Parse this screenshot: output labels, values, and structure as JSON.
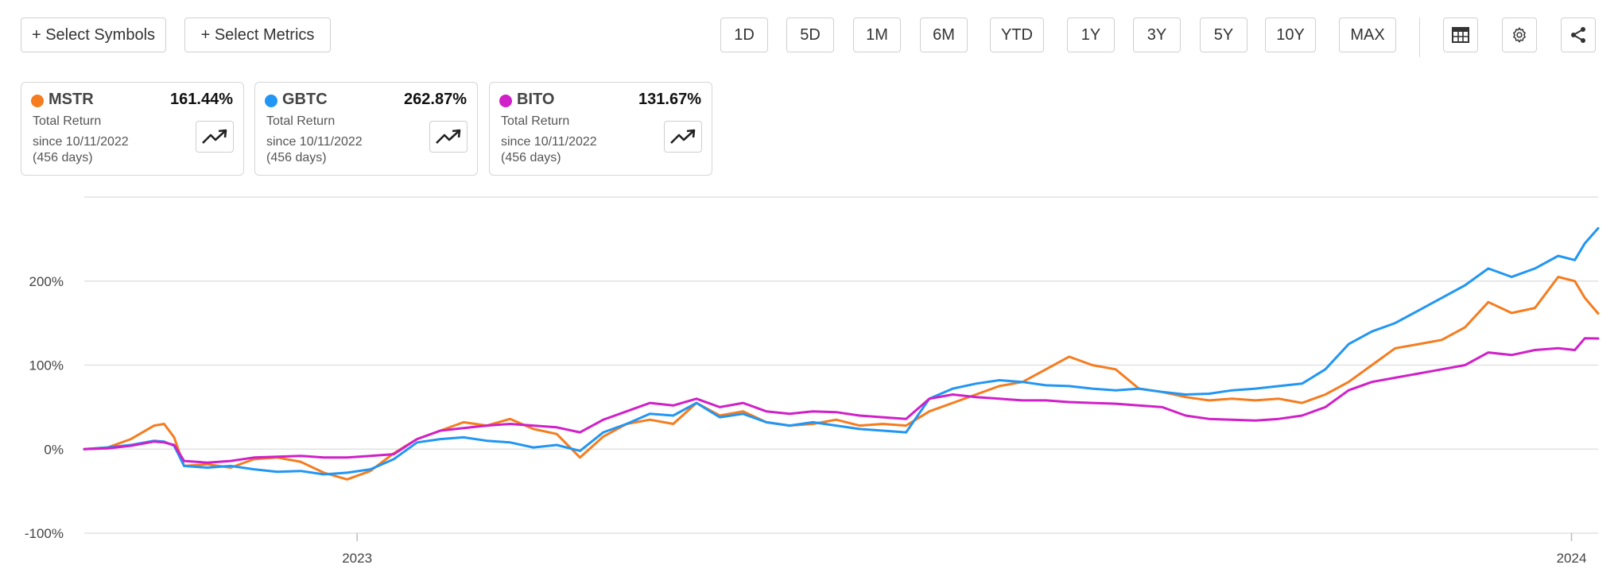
{
  "toolbar": {
    "select_symbols_label": "+ Select Symbols",
    "select_metrics_label": "+ Select Metrics",
    "ranges": [
      "1D",
      "5D",
      "1M",
      "6M",
      "YTD",
      "1Y",
      "3Y",
      "5Y",
      "10Y",
      "MAX"
    ],
    "icons": [
      "table-icon",
      "gear-icon",
      "share-icon"
    ]
  },
  "cards": [
    {
      "symbol": "MSTR",
      "value": "161.44%",
      "metric": "Total Return",
      "since": "since 10/11/2022",
      "days": "(456 days)",
      "color": "#f57c1f"
    },
    {
      "symbol": "GBTC",
      "value": "262.87%",
      "metric": "Total Return",
      "since": "since 10/11/2022",
      "days": "(456 days)",
      "color": "#2196f3"
    },
    {
      "symbol": "BITO",
      "value": "131.67%",
      "metric": "Total Return",
      "since": "since 10/11/2022",
      "days": "(456 days)",
      "color": "#d020c8"
    }
  ],
  "chart_data": {
    "type": "line",
    "ylim": [
      -100,
      300
    ],
    "yticks": [
      -100,
      0,
      100,
      200
    ],
    "ytick_labels": [
      "-100%",
      "0%",
      "100%",
      "200%"
    ],
    "xlim": [
      "2022-10-11",
      "2024-01-09"
    ],
    "xticks": [
      {
        "date": "2023-01-01",
        "label": "2023"
      },
      {
        "date": "2024-01-01",
        "label": "2024"
      }
    ],
    "grid": true,
    "legend": "none",
    "series": [
      {
        "name": "MSTR",
        "color": "#f57c1f",
        "points": [
          [
            "2022-10-11",
            0
          ],
          [
            "2022-10-18",
            2
          ],
          [
            "2022-10-25",
            12
          ],
          [
            "2022-11-01",
            28
          ],
          [
            "2022-11-04",
            30
          ],
          [
            "2022-11-07",
            14
          ],
          [
            "2022-11-10",
            -20
          ],
          [
            "2022-11-17",
            -18
          ],
          [
            "2022-11-24",
            -22
          ],
          [
            "2022-12-01",
            -12
          ],
          [
            "2022-12-08",
            -10
          ],
          [
            "2022-12-15",
            -15
          ],
          [
            "2022-12-22",
            -28
          ],
          [
            "2022-12-29",
            -36
          ],
          [
            "2023-01-05",
            -26
          ],
          [
            "2023-01-12",
            -5
          ],
          [
            "2023-01-19",
            12
          ],
          [
            "2023-01-26",
            22
          ],
          [
            "2023-02-02",
            32
          ],
          [
            "2023-02-09",
            28
          ],
          [
            "2023-02-16",
            36
          ],
          [
            "2023-02-23",
            24
          ],
          [
            "2023-03-02",
            18
          ],
          [
            "2023-03-09",
            -10
          ],
          [
            "2023-03-16",
            15
          ],
          [
            "2023-03-23",
            30
          ],
          [
            "2023-03-30",
            35
          ],
          [
            "2023-04-06",
            30
          ],
          [
            "2023-04-13",
            55
          ],
          [
            "2023-04-20",
            40
          ],
          [
            "2023-04-27",
            45
          ],
          [
            "2023-05-04",
            32
          ],
          [
            "2023-05-11",
            28
          ],
          [
            "2023-05-18",
            30
          ],
          [
            "2023-05-25",
            35
          ],
          [
            "2023-06-01",
            28
          ],
          [
            "2023-06-08",
            30
          ],
          [
            "2023-06-15",
            28
          ],
          [
            "2023-06-22",
            45
          ],
          [
            "2023-06-29",
            55
          ],
          [
            "2023-07-06",
            65
          ],
          [
            "2023-07-13",
            75
          ],
          [
            "2023-07-20",
            80
          ],
          [
            "2023-07-27",
            95
          ],
          [
            "2023-08-03",
            110
          ],
          [
            "2023-08-10",
            100
          ],
          [
            "2023-08-17",
            95
          ],
          [
            "2023-08-24",
            72
          ],
          [
            "2023-08-31",
            68
          ],
          [
            "2023-09-07",
            62
          ],
          [
            "2023-09-14",
            58
          ],
          [
            "2023-09-21",
            60
          ],
          [
            "2023-09-28",
            58
          ],
          [
            "2023-10-05",
            60
          ],
          [
            "2023-10-12",
            55
          ],
          [
            "2023-10-19",
            65
          ],
          [
            "2023-10-26",
            80
          ],
          [
            "2023-11-02",
            100
          ],
          [
            "2023-11-09",
            120
          ],
          [
            "2023-11-16",
            125
          ],
          [
            "2023-11-23",
            130
          ],
          [
            "2023-11-30",
            145
          ],
          [
            "2023-12-07",
            175
          ],
          [
            "2023-12-14",
            162
          ],
          [
            "2023-12-21",
            168
          ],
          [
            "2023-12-28",
            205
          ],
          [
            "2024-01-02",
            200
          ],
          [
            "2024-01-05",
            180
          ],
          [
            "2024-01-09",
            161.44
          ]
        ]
      },
      {
        "name": "GBTC",
        "color": "#2196f3",
        "points": [
          [
            "2022-10-11",
            0
          ],
          [
            "2022-10-18",
            2
          ],
          [
            "2022-10-25",
            5
          ],
          [
            "2022-11-01",
            10
          ],
          [
            "2022-11-04",
            9
          ],
          [
            "2022-11-07",
            4
          ],
          [
            "2022-11-10",
            -20
          ],
          [
            "2022-11-17",
            -22
          ],
          [
            "2022-11-24",
            -20
          ],
          [
            "2022-12-01",
            -24
          ],
          [
            "2022-12-08",
            -27
          ],
          [
            "2022-12-15",
            -26
          ],
          [
            "2022-12-22",
            -30
          ],
          [
            "2022-12-29",
            -28
          ],
          [
            "2023-01-05",
            -24
          ],
          [
            "2023-01-12",
            -12
          ],
          [
            "2023-01-19",
            8
          ],
          [
            "2023-01-26",
            12
          ],
          [
            "2023-02-02",
            14
          ],
          [
            "2023-02-09",
            10
          ],
          [
            "2023-02-16",
            8
          ],
          [
            "2023-02-23",
            2
          ],
          [
            "2023-03-02",
            5
          ],
          [
            "2023-03-09",
            -2
          ],
          [
            "2023-03-16",
            20
          ],
          [
            "2023-03-23",
            30
          ],
          [
            "2023-03-30",
            42
          ],
          [
            "2023-04-06",
            40
          ],
          [
            "2023-04-13",
            55
          ],
          [
            "2023-04-20",
            38
          ],
          [
            "2023-04-27",
            42
          ],
          [
            "2023-05-04",
            32
          ],
          [
            "2023-05-11",
            28
          ],
          [
            "2023-05-18",
            32
          ],
          [
            "2023-05-25",
            28
          ],
          [
            "2023-06-01",
            24
          ],
          [
            "2023-06-08",
            22
          ],
          [
            "2023-06-15",
            20
          ],
          [
            "2023-06-22",
            60
          ],
          [
            "2023-06-29",
            72
          ],
          [
            "2023-07-06",
            78
          ],
          [
            "2023-07-13",
            82
          ],
          [
            "2023-07-20",
            80
          ],
          [
            "2023-07-27",
            76
          ],
          [
            "2023-08-03",
            75
          ],
          [
            "2023-08-10",
            72
          ],
          [
            "2023-08-17",
            70
          ],
          [
            "2023-08-24",
            72
          ],
          [
            "2023-08-31",
            68
          ],
          [
            "2023-09-07",
            65
          ],
          [
            "2023-09-14",
            66
          ],
          [
            "2023-09-21",
            70
          ],
          [
            "2023-09-28",
            72
          ],
          [
            "2023-10-05",
            75
          ],
          [
            "2023-10-12",
            78
          ],
          [
            "2023-10-19",
            95
          ],
          [
            "2023-10-26",
            125
          ],
          [
            "2023-11-02",
            140
          ],
          [
            "2023-11-09",
            150
          ],
          [
            "2023-11-16",
            165
          ],
          [
            "2023-11-23",
            180
          ],
          [
            "2023-11-30",
            195
          ],
          [
            "2023-12-07",
            215
          ],
          [
            "2023-12-14",
            205
          ],
          [
            "2023-12-21",
            215
          ],
          [
            "2023-12-28",
            230
          ],
          [
            "2024-01-02",
            225
          ],
          [
            "2024-01-05",
            245
          ],
          [
            "2024-01-09",
            262.87
          ]
        ]
      },
      {
        "name": "BITO",
        "color": "#d020c8",
        "points": [
          [
            "2022-10-11",
            0
          ],
          [
            "2022-10-18",
            1
          ],
          [
            "2022-10-25",
            4
          ],
          [
            "2022-11-01",
            9
          ],
          [
            "2022-11-04",
            8
          ],
          [
            "2022-11-07",
            5
          ],
          [
            "2022-11-10",
            -14
          ],
          [
            "2022-11-17",
            -16
          ],
          [
            "2022-11-24",
            -14
          ],
          [
            "2022-12-01",
            -10
          ],
          [
            "2022-12-08",
            -9
          ],
          [
            "2022-12-15",
            -8
          ],
          [
            "2022-12-22",
            -10
          ],
          [
            "2022-12-29",
            -10
          ],
          [
            "2023-01-05",
            -8
          ],
          [
            "2023-01-12",
            -6
          ],
          [
            "2023-01-19",
            12
          ],
          [
            "2023-01-26",
            22
          ],
          [
            "2023-02-02",
            25
          ],
          [
            "2023-02-09",
            28
          ],
          [
            "2023-02-16",
            30
          ],
          [
            "2023-02-23",
            28
          ],
          [
            "2023-03-02",
            26
          ],
          [
            "2023-03-09",
            20
          ],
          [
            "2023-03-16",
            35
          ],
          [
            "2023-03-23",
            45
          ],
          [
            "2023-03-30",
            55
          ],
          [
            "2023-04-06",
            52
          ],
          [
            "2023-04-13",
            60
          ],
          [
            "2023-04-20",
            50
          ],
          [
            "2023-04-27",
            55
          ],
          [
            "2023-05-04",
            45
          ],
          [
            "2023-05-11",
            42
          ],
          [
            "2023-05-18",
            45
          ],
          [
            "2023-05-25",
            44
          ],
          [
            "2023-06-01",
            40
          ],
          [
            "2023-06-08",
            38
          ],
          [
            "2023-06-15",
            36
          ],
          [
            "2023-06-22",
            60
          ],
          [
            "2023-06-29",
            65
          ],
          [
            "2023-07-06",
            62
          ],
          [
            "2023-07-13",
            60
          ],
          [
            "2023-07-20",
            58
          ],
          [
            "2023-07-27",
            58
          ],
          [
            "2023-08-03",
            56
          ],
          [
            "2023-08-10",
            55
          ],
          [
            "2023-08-17",
            54
          ],
          [
            "2023-08-24",
            52
          ],
          [
            "2023-08-31",
            50
          ],
          [
            "2023-09-07",
            40
          ],
          [
            "2023-09-14",
            36
          ],
          [
            "2023-09-21",
            35
          ],
          [
            "2023-09-28",
            34
          ],
          [
            "2023-10-05",
            36
          ],
          [
            "2023-10-12",
            40
          ],
          [
            "2023-10-19",
            50
          ],
          [
            "2023-10-26",
            70
          ],
          [
            "2023-11-02",
            80
          ],
          [
            "2023-11-09",
            85
          ],
          [
            "2023-11-16",
            90
          ],
          [
            "2023-11-23",
            95
          ],
          [
            "2023-11-30",
            100
          ],
          [
            "2023-12-07",
            115
          ],
          [
            "2023-12-14",
            112
          ],
          [
            "2023-12-21",
            118
          ],
          [
            "2023-12-28",
            120
          ],
          [
            "2024-01-02",
            118
          ],
          [
            "2024-01-05",
            132
          ],
          [
            "2024-01-09",
            131.67
          ]
        ]
      }
    ]
  }
}
